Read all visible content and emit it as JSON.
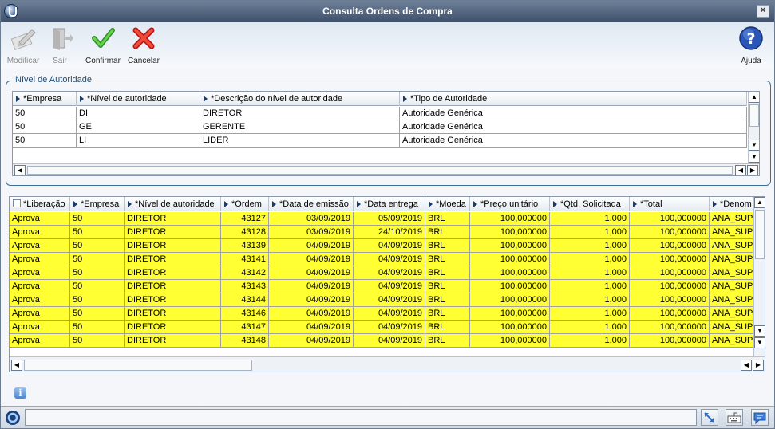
{
  "window": {
    "title": "Consulta Ordens de Compra",
    "close_glyph": "×"
  },
  "toolbar": {
    "modify_label": "Modificar",
    "exit_label": "Sair",
    "confirm_label": "Confirmar",
    "cancel_label": "Cancelar",
    "help_label": "Ajuda"
  },
  "authority_group": {
    "label": "Nível de Autoridade",
    "columns": [
      "*Empresa",
      "*Nível de autoridade",
      "*Descrição do nível de autoridade",
      "*Tipo de Autoridade"
    ],
    "rows": [
      [
        "50",
        "DI",
        "DIRETOR",
        "Autoridade Genérica"
      ],
      [
        "50",
        "GE",
        "GERENTE",
        "Autoridade Genérica"
      ],
      [
        "50",
        "LI",
        "LIDER",
        "Autoridade Genérica"
      ]
    ]
  },
  "orders_grid": {
    "columns": [
      "*Liberação",
      "*Empresa",
      "*Nível de autoridade",
      "*Ordem",
      "*Data de emissão",
      "*Data entrega",
      "*Moeda",
      "*Preço unitário",
      "*Qtd. Solicitada",
      "*Total",
      "*Denom"
    ],
    "rows": [
      [
        "Aprova",
        "50",
        "DIRETOR",
        "43127",
        "03/09/2019",
        "05/09/2019",
        "BRL",
        "100,000000",
        "1,000",
        "100,000000",
        "ANA_SUP"
      ],
      [
        "Aprova",
        "50",
        "DIRETOR",
        "43128",
        "03/09/2019",
        "24/10/2019",
        "BRL",
        "100,000000",
        "1,000",
        "100,000000",
        "ANA_SUP"
      ],
      [
        "Aprova",
        "50",
        "DIRETOR",
        "43139",
        "04/09/2019",
        "04/09/2019",
        "BRL",
        "100,000000",
        "1,000",
        "100,000000",
        "ANA_SUP"
      ],
      [
        "Aprova",
        "50",
        "DIRETOR",
        "43141",
        "04/09/2019",
        "04/09/2019",
        "BRL",
        "100,000000",
        "1,000",
        "100,000000",
        "ANA_SUP"
      ],
      [
        "Aprova",
        "50",
        "DIRETOR",
        "43142",
        "04/09/2019",
        "04/09/2019",
        "BRL",
        "100,000000",
        "1,000",
        "100,000000",
        "ANA_SUP"
      ],
      [
        "Aprova",
        "50",
        "DIRETOR",
        "43143",
        "04/09/2019",
        "04/09/2019",
        "BRL",
        "100,000000",
        "1,000",
        "100,000000",
        "ANA_SUP"
      ],
      [
        "Aprova",
        "50",
        "DIRETOR",
        "43144",
        "04/09/2019",
        "04/09/2019",
        "BRL",
        "100,000000",
        "1,000",
        "100,000000",
        "ANA_SUP"
      ],
      [
        "Aprova",
        "50",
        "DIRETOR",
        "43146",
        "04/09/2019",
        "04/09/2019",
        "BRL",
        "100,000000",
        "1,000",
        "100,000000",
        "ANA_SUP"
      ],
      [
        "Aprova",
        "50",
        "DIRETOR",
        "43147",
        "04/09/2019",
        "04/09/2019",
        "BRL",
        "100,000000",
        "1,000",
        "100,000000",
        "ANA_SUP"
      ],
      [
        "Aprova",
        "50",
        "DIRETOR",
        "43148",
        "04/09/2019",
        "04/09/2019",
        "BRL",
        "100,000000",
        "1,000",
        "100,000000",
        "ANA_SUP"
      ]
    ],
    "row_color": "#ffff33"
  },
  "icons": {
    "app": "app-logo-icon",
    "modify": "pencil-icon",
    "exit": "exit-door-icon",
    "confirm": "checkmark-icon",
    "cancel": "x-icon",
    "help": "help-icon",
    "info": "info-icon",
    "status_left": "protheus-logo-icon",
    "status_right": [
      "resize-icon",
      "keyboard-icon",
      "chat-icon"
    ]
  },
  "status": {
    "text": ""
  }
}
